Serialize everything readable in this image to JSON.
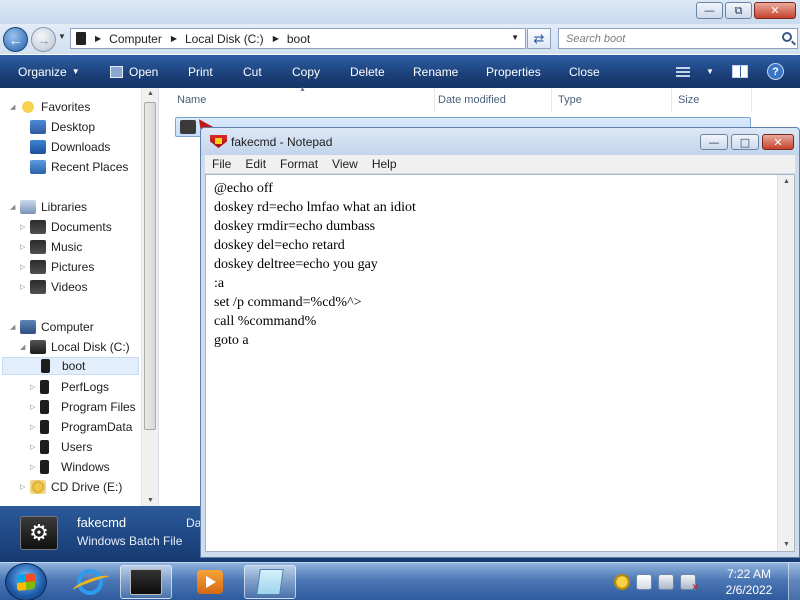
{
  "explorer": {
    "address": {
      "crumbs": [
        "Computer",
        "Local Disk (C:)",
        "boot"
      ]
    },
    "search_placeholder": "Search boot",
    "toolbar": {
      "organize": "Organize",
      "open": "Open",
      "print": "Print",
      "cut": "Cut",
      "copy": "Copy",
      "delete": "Delete",
      "rename": "Rename",
      "properties": "Properties",
      "close": "Close",
      "help": "?"
    },
    "nav": {
      "favorites": "Favorites",
      "desktop": "Desktop",
      "downloads": "Downloads",
      "recent_places": "Recent Places",
      "libraries": "Libraries",
      "documents": "Documents",
      "music": "Music",
      "pictures": "Pictures",
      "videos": "Videos",
      "computer": "Computer",
      "local_disk": "Local Disk (C:)",
      "boot": "boot",
      "perflogs": "PerfLogs",
      "program_files": "Program Files",
      "program_data": "ProgramData",
      "users": "Users",
      "windows": "Windows",
      "cd_drive": "CD Drive (E:)"
    },
    "columns": [
      "Name",
      "Date modified",
      "Type",
      "Size"
    ],
    "details": {
      "name": "fakecmd",
      "type": "Windows Batch File",
      "date_label": "Da"
    },
    "window_buttons": {
      "minimize": "—",
      "maximize": "⧉",
      "close": "✕"
    }
  },
  "notepad": {
    "title": "fakecmd - Notepad",
    "menu": [
      "File",
      "Edit",
      "Format",
      "View",
      "Help"
    ],
    "content": "@echo off\ndoskey rd=echo lmfao what an idiot\ndoskey rmdir=echo dumbass\ndoskey del=echo retard\ndoskey deltree=echo you gay\n:a\nset /p command=%cd%^>\ncall %command%\ngoto a",
    "window_buttons": {
      "minimize": "—",
      "maximize": "□",
      "close": "✕"
    }
  },
  "taskbar": {
    "time": "7:22 AM",
    "date": "2/6/2022"
  },
  "colors": {
    "toolbar_blue": "#1b3f78",
    "selection": "#c4ddfb",
    "taskbar": "#4d78b5"
  }
}
